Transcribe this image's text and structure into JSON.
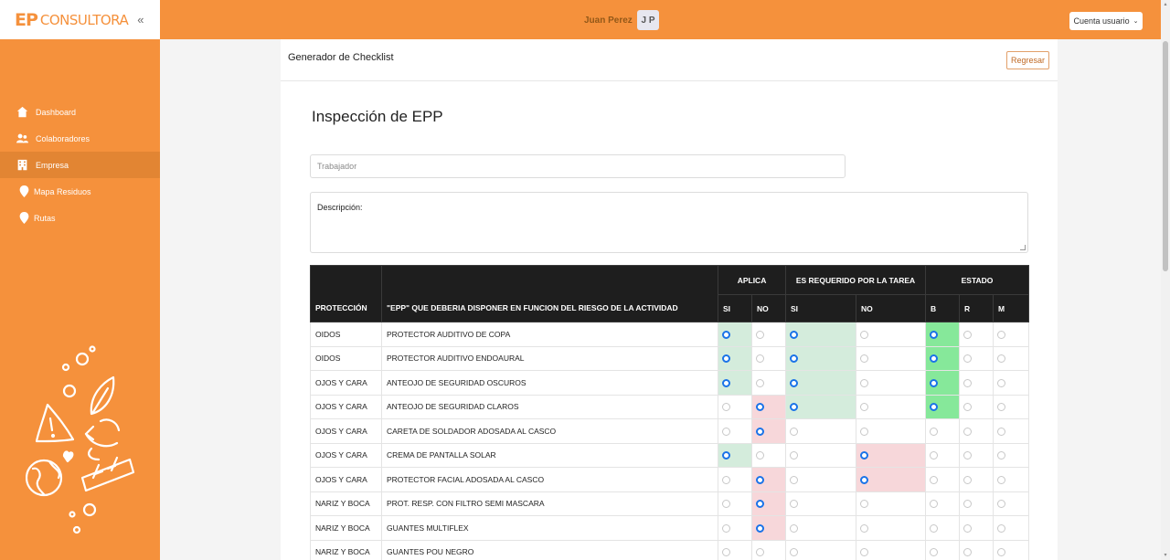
{
  "app": {
    "logo_ep": "EP",
    "logo_name": "CONSULTORA",
    "collapse_icon": "double-chevron-left-icon"
  },
  "header": {
    "user_name": "Juan Perez",
    "avatar_initials": "J P",
    "account_button": "Cuenta usuario"
  },
  "sidebar": {
    "items": [
      {
        "label": "Dashboard",
        "icon": "home-icon",
        "active": false
      },
      {
        "label": "Colaboradores",
        "icon": "users-icon",
        "active": false
      },
      {
        "label": "Empresa",
        "icon": "building-icon",
        "active": true
      },
      {
        "label": "Mapa Residuos",
        "icon": "map-pin-icon",
        "active": false
      },
      {
        "label": "Rutas",
        "icon": "map-pin-icon",
        "active": false
      }
    ]
  },
  "panel": {
    "title": "Generador de Checklist",
    "back_button": "Regresar",
    "form_title": "Inspección de EPP",
    "worker_placeholder": "Trabajador",
    "description_label": "Descripción:"
  },
  "table": {
    "col_proteccion": "PROTECCIÓN",
    "col_epp": "\"EPP\" QUE DEBERIA DISPONER EN FUNCION DEL RIESGO DE LA ACTIVIDAD",
    "group_aplica": "APLICA",
    "group_requerido": "ES REQUERIDO POR LA TAREA",
    "group_estado": "ESTADO",
    "sub_si": "SI",
    "sub_no": "NO",
    "sub_b": "B",
    "sub_r": "R",
    "sub_m": "M",
    "colors": {
      "green": "#d4ecdc",
      "red": "#f7d7da",
      "bright_green": "#86e89a",
      "header_bg": "#1e1e1e"
    },
    "rows": [
      {
        "proteccion": "OIDOS",
        "epp": "PROTECTOR AUDITIVO DE COPA",
        "aplica": "SI",
        "requerido": "SI",
        "estado": "B"
      },
      {
        "proteccion": "OIDOS",
        "epp": "PROTECTOR AUDITIVO ENDOAURAL",
        "aplica": "SI",
        "requerido": "SI",
        "estado": "B"
      },
      {
        "proteccion": "OJOS Y CARA",
        "epp": "ANTEOJO DE SEGURIDAD OSCUROS",
        "aplica": "SI",
        "requerido": "SI",
        "estado": "B"
      },
      {
        "proteccion": "OJOS Y CARA",
        "epp": "ANTEOJO DE SEGURIDAD CLAROS",
        "aplica": "NO",
        "requerido": "SI",
        "estado": "B"
      },
      {
        "proteccion": "OJOS Y CARA",
        "epp": "CARETA DE SOLDADOR ADOSADA AL CASCO",
        "aplica": "NO",
        "requerido": "",
        "estado": ""
      },
      {
        "proteccion": "OJOS Y CARA",
        "epp": "CREMA DE PANTALLA SOLAR",
        "aplica": "SI",
        "requerido": "NO",
        "estado": ""
      },
      {
        "proteccion": "OJOS Y CARA",
        "epp": "PROTECTOR FACIAL ADOSADA AL CASCO",
        "aplica": "NO",
        "requerido": "NO",
        "estado": ""
      },
      {
        "proteccion": "NARIZ Y BOCA",
        "epp": "PROT. RESP. CON FILTRO SEMI MASCARA",
        "aplica": "NO",
        "requerido": "",
        "estado": ""
      },
      {
        "proteccion": "NARIZ Y BOCA",
        "epp": "GUANTES MULTIFLEX",
        "aplica": "NO",
        "requerido": "",
        "estado": ""
      },
      {
        "proteccion": "NARIZ Y BOCA",
        "epp": "GUANTES POU NEGRO",
        "aplica": "",
        "requerido": "",
        "estado": ""
      }
    ]
  }
}
